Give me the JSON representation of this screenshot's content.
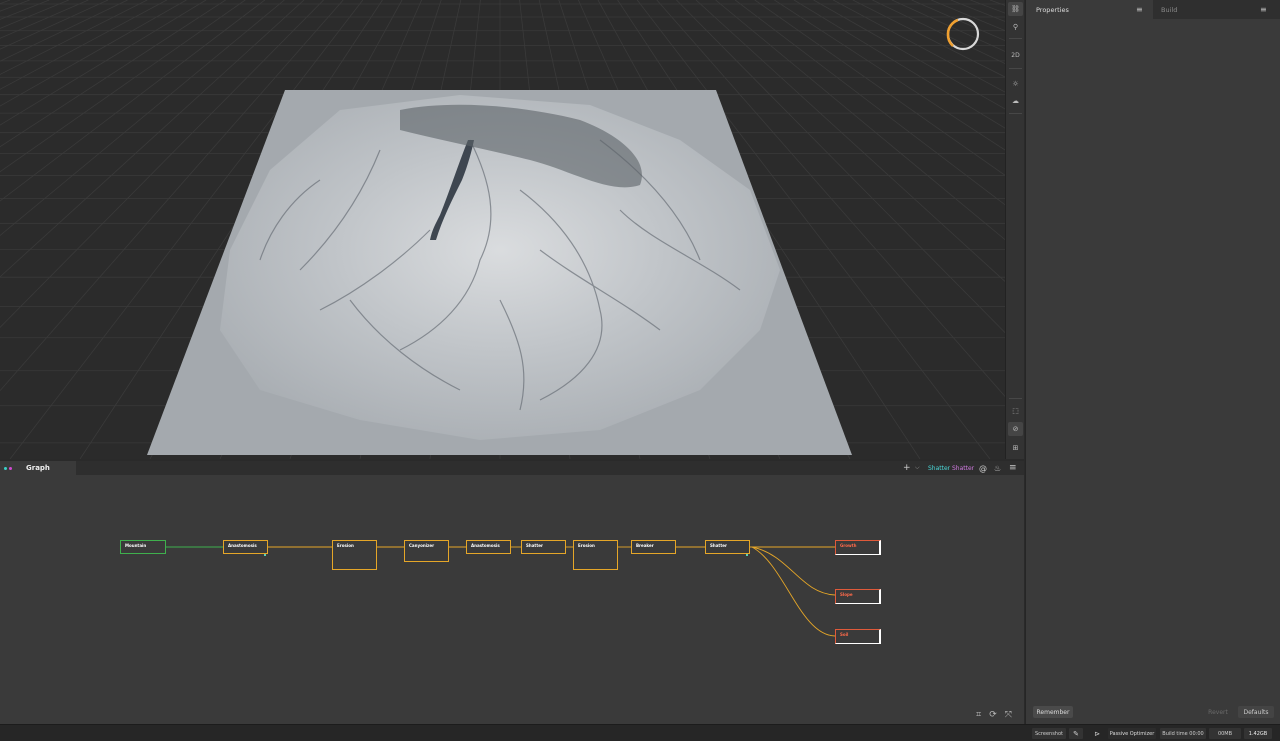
{
  "viewport": {
    "compass_accent": "#f0a030",
    "toolbar": {
      "top_buttons": [
        {
          "icon": "link-icon",
          "glyph": "⛓"
        },
        {
          "icon": "person-icon",
          "glyph": "⚲"
        },
        {
          "icon": "2d-toggle",
          "glyph": "2D"
        },
        {
          "icon": "sun-icon",
          "glyph": "☼"
        },
        {
          "icon": "cloud-icon",
          "glyph": "☁"
        }
      ],
      "bottom_buttons": [
        {
          "icon": "frame-icon",
          "glyph": "⬚"
        },
        {
          "icon": "compass-icon",
          "glyph": "⊘"
        },
        {
          "icon": "grid-icon",
          "glyph": "⊞"
        }
      ]
    }
  },
  "graph": {
    "tab_label": "Graph",
    "dot_colors": [
      "#3ad0c8",
      "#d04ad0"
    ],
    "header": {
      "add_glyph": "+",
      "add_dropdown_glyph": "⌵",
      "shatter_cyan": "Shatter",
      "shatter_purple": "Shatter",
      "shatter_cyan_color": "#4ad8d8",
      "shatter_purple_color": "#d07ae0",
      "at_glyph": "@",
      "fire_glyph": "♨",
      "menu_glyph": "≡"
    },
    "nodes": [
      {
        "id": "n1",
        "label": "Mountain",
        "kind": "green"
      },
      {
        "id": "n2",
        "label": "Anastomosis",
        "kind": "normal"
      },
      {
        "id": "n3",
        "label": "Erosion",
        "kind": "normal"
      },
      {
        "id": "n4",
        "label": "Canyonizer",
        "kind": "normal"
      },
      {
        "id": "n5",
        "label": "Anastomosis",
        "kind": "normal"
      },
      {
        "id": "n6",
        "label": "Shatter",
        "kind": "normal"
      },
      {
        "id": "n7",
        "label": "Erosion",
        "kind": "normal"
      },
      {
        "id": "n8",
        "label": "Breaker",
        "kind": "normal"
      },
      {
        "id": "n9",
        "label": "Shatter",
        "kind": "normal"
      },
      {
        "id": "n10",
        "label": "Growth",
        "kind": "red"
      },
      {
        "id": "n11",
        "label": "Slope",
        "kind": "red"
      },
      {
        "id": "n12",
        "label": "Soil",
        "kind": "red"
      }
    ],
    "bottom_icons": [
      {
        "icon": "frame-all-icon",
        "glyph": "⌗"
      },
      {
        "icon": "refresh-icon",
        "glyph": "⟳"
      },
      {
        "icon": "collapse-icon",
        "glyph": "⤧"
      }
    ]
  },
  "side_panel": {
    "properties_tab": "Properties",
    "build_tab": "Build",
    "menu_glyph": "≡",
    "remember_button": "Remember",
    "reset_button": "Revert",
    "defaults_button": "Defaults"
  },
  "status_bar": {
    "screenshot": "Screenshot",
    "pencil_glyph": "✎",
    "play_glyph": "⊳",
    "optimizer": "Passive Optimizer",
    "build_time": "Build time 00:00",
    "memory": "00MB",
    "ram": "1.42GB"
  }
}
